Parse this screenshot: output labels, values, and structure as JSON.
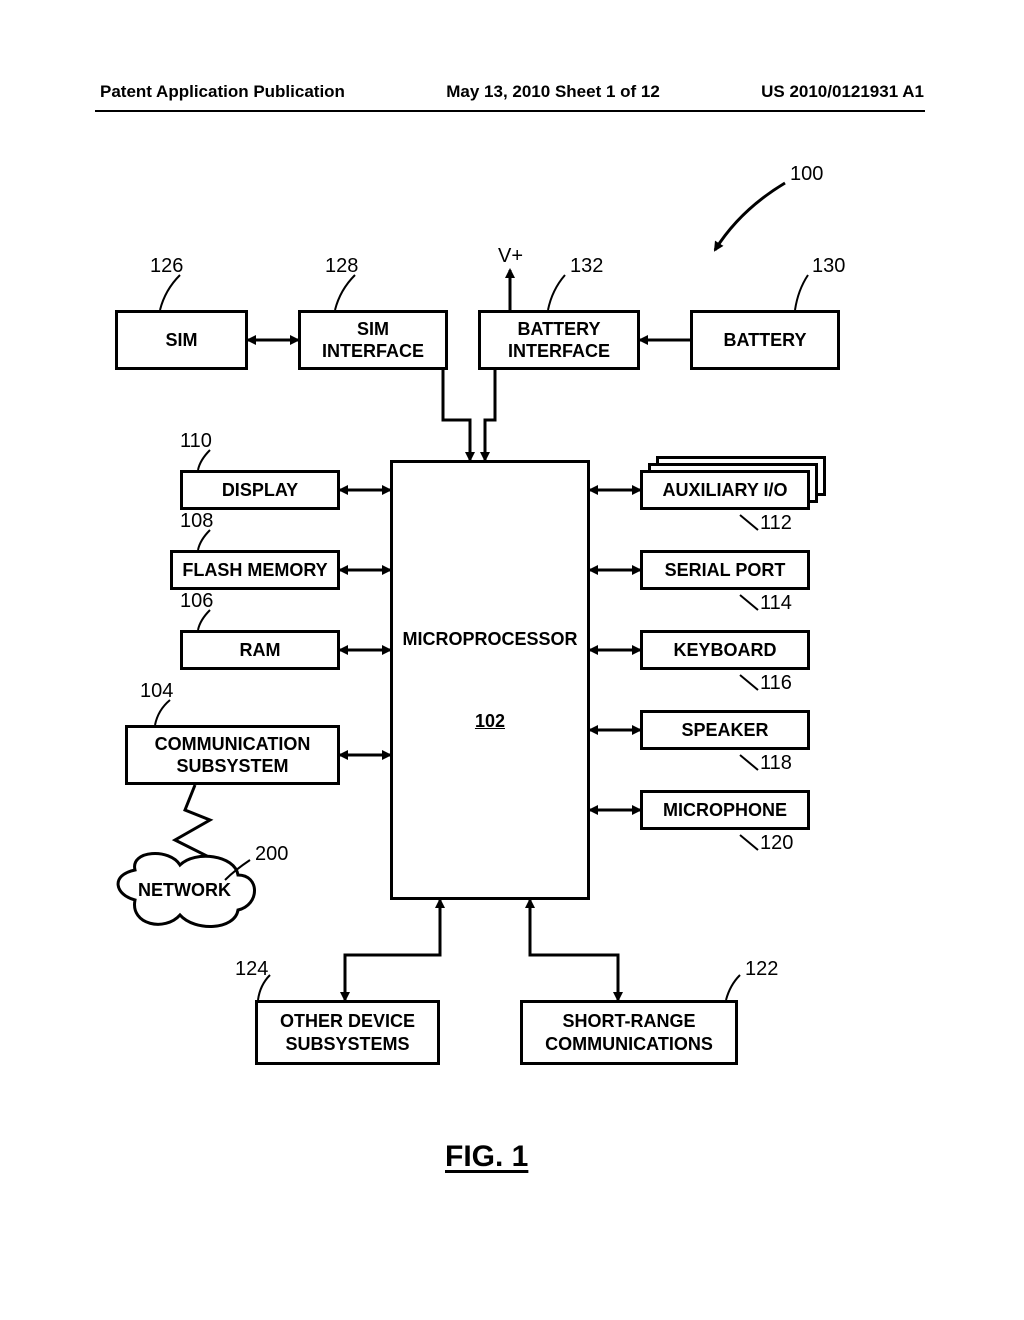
{
  "header": {
    "left": "Patent Application Publication",
    "center": "May 13, 2010  Sheet 1 of 12",
    "right": "US 2010/0121931 A1"
  },
  "figure_caption": "FIG. 1",
  "vplus": "V+",
  "blocks": {
    "sim": {
      "label": "SIM",
      "ref": "126"
    },
    "sim_interface": {
      "label": "SIM\nINTERFACE",
      "ref": "128"
    },
    "battery_interface": {
      "label": "BATTERY\nINTERFACE",
      "ref": "132"
    },
    "battery": {
      "label": "BATTERY",
      "ref": "130"
    },
    "display": {
      "label": "DISPLAY",
      "ref": "110"
    },
    "flash_memory": {
      "label": "FLASH MEMORY",
      "ref": "108"
    },
    "ram": {
      "label": "RAM",
      "ref": "106"
    },
    "comm_subsystem": {
      "label": "COMMUNICATION\nSUBSYSTEM",
      "ref": "104"
    },
    "network": {
      "label": "NETWORK",
      "ref": "200"
    },
    "microprocessor": {
      "label": "MICROPROCESSOR",
      "ref": "102"
    },
    "aux_io": {
      "label": "AUXILIARY I/O",
      "ref": "112"
    },
    "serial_port": {
      "label": "SERIAL PORT",
      "ref": "114"
    },
    "keyboard": {
      "label": "KEYBOARD",
      "ref": "116"
    },
    "speaker": {
      "label": "SPEAKER",
      "ref": "118"
    },
    "microphone": {
      "label": "MICROPHONE",
      "ref": "120"
    },
    "other_device": {
      "label": "OTHER DEVICE\nSUBSYSTEMS",
      "ref": "124"
    },
    "short_range": {
      "label": "SHORT-RANGE\nCOMMUNICATIONS",
      "ref": "122"
    }
  },
  "system_ref": "100"
}
